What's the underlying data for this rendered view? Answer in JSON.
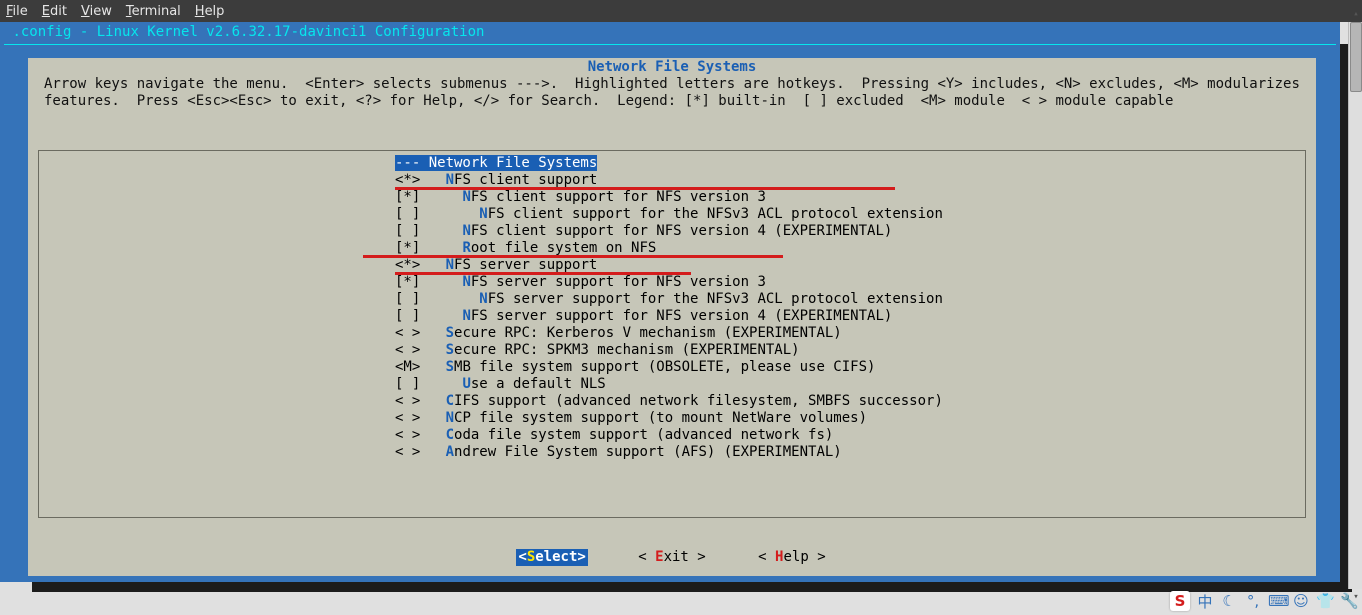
{
  "menubar": {
    "file": "File",
    "edit": "Edit",
    "view": "View",
    "terminal": "Terminal",
    "help": "Help"
  },
  "term_title": ".config - Linux Kernel v2.6.32.17-davinci1 Configuration",
  "cfg": {
    "section_title": "Network File Systems",
    "instructions_line1": "Arrow keys navigate the menu.  <Enter> selects submenus --->.  Highlighted letters are hotkeys.  Pressing <Y> includes, <N> excludes, <M> modularizes",
    "instructions_line2": "features.  Press <Esc><Esc> to exit, <?> for Help, </> for Search.  Legend: [*] built-in  [ ] excluded  <M> module  < > module capable",
    "header_row": "--- Network File Systems",
    "items": [
      {
        "mark": "<*>",
        "indent": "   ",
        "hot": "N",
        "pre": "",
        "rest": "FS client support"
      },
      {
        "mark": "[*]",
        "indent": "     ",
        "hot": "N",
        "pre": "",
        "rest": "FS client support for NFS version 3"
      },
      {
        "mark": "[ ]",
        "indent": "       ",
        "hot": "N",
        "pre": "",
        "rest": "FS client support for the NFSv3 ACL protocol extension"
      },
      {
        "mark": "[ ]",
        "indent": "     ",
        "hot": "N",
        "pre": "",
        "rest": "FS client support for NFS version 4 (EXPERIMENTAL)"
      },
      {
        "mark": "[*]",
        "indent": "     ",
        "hot": "R",
        "pre": "",
        "rest": "oot file system on NFS"
      },
      {
        "mark": "<*>",
        "indent": "   ",
        "hot": "N",
        "pre": "",
        "rest": "FS server support"
      },
      {
        "mark": "[*]",
        "indent": "     ",
        "hot": "N",
        "pre": "",
        "rest": "FS server support for NFS version 3"
      },
      {
        "mark": "[ ]",
        "indent": "       ",
        "hot": "N",
        "pre": "",
        "rest": "FS server support for the NFSv3 ACL protocol extension"
      },
      {
        "mark": "[ ]",
        "indent": "     ",
        "hot": "N",
        "pre": "",
        "rest": "FS server support for NFS version 4 (EXPERIMENTAL)"
      },
      {
        "mark": "< >",
        "indent": "   ",
        "hot": "S",
        "pre": "",
        "rest": "ecure RPC: Kerberos V mechanism (EXPERIMENTAL)"
      },
      {
        "mark": "< >",
        "indent": "   ",
        "hot": "S",
        "pre": "",
        "rest": "ecure RPC: SPKM3 mechanism (EXPERIMENTAL)"
      },
      {
        "mark": "<M>",
        "indent": "   ",
        "hot": "S",
        "pre": "",
        "rest": "MB file system support (OBSOLETE, please use CIFS)"
      },
      {
        "mark": "[ ]",
        "indent": "     ",
        "hot": "U",
        "pre": "",
        "rest": "se a default NLS"
      },
      {
        "mark": "< >",
        "indent": "   ",
        "hot": "C",
        "pre": "",
        "rest": "IFS support (advanced network filesystem, SMBFS successor)"
      },
      {
        "mark": "< >",
        "indent": "   ",
        "hot": "N",
        "pre": "",
        "rest": "CP file system support (to mount NetWare volumes)"
      },
      {
        "mark": "< >",
        "indent": "   ",
        "hot": "C",
        "pre": "",
        "rest": "oda file system support (advanced network fs)"
      },
      {
        "mark": "< >",
        "indent": "   ",
        "hot": "A",
        "pre": "",
        "rest": "ndrew File System support (AFS) (EXPERIMENTAL)"
      }
    ],
    "buttons": {
      "select": {
        "bra": "<",
        "hot": "S",
        "rest": "elect",
        "ket": ">"
      },
      "exit": {
        "bra": "< ",
        "hot": "E",
        "rest": "xit ",
        "ket": ">"
      },
      "help": {
        "bra": "< ",
        "hot": "H",
        "rest": "elp ",
        "ket": ">"
      }
    }
  },
  "tray": {
    "ime_badge": "S",
    "lang": "中",
    "icons": [
      "moon",
      "punct",
      "keyboard",
      "person",
      "shirt",
      "wrench"
    ]
  }
}
